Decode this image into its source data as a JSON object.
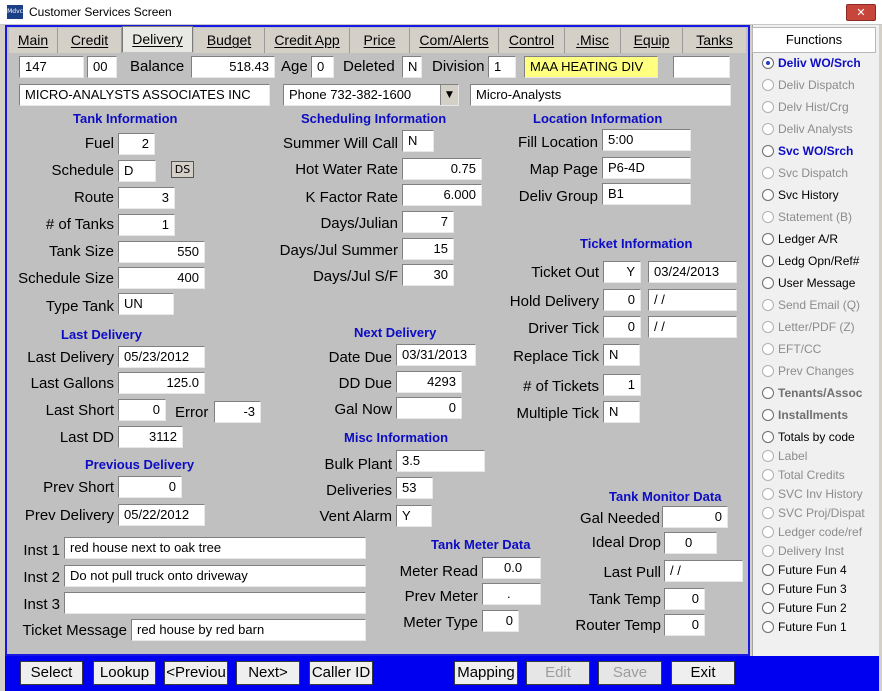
{
  "window": {
    "title": "Customer Services Screen",
    "app_icon_text": "Mdvc",
    "close_glyph": "✕"
  },
  "tabs": [
    "Main",
    "Credit",
    "Delivery",
    "Budget",
    "Credit App",
    "Price",
    "Com/Alerts",
    "Control",
    ".Misc",
    "Equip",
    "Tanks"
  ],
  "active_tab": "Delivery",
  "header": {
    "account": "147",
    "sub": "00",
    "balance_label": "Balance",
    "balance": "518.43",
    "age_label": "Age",
    "age": "0",
    "deleted_label": "Deleted",
    "deleted": "N",
    "division_label": "Division",
    "division": "1",
    "division_name": "MAA HEATING  DIV",
    "extra": "",
    "company": "MICRO-ANALYSTS ASSOCIATES INC",
    "phone": "Phone 732-382-1600",
    "short_name": "Micro-Analysts"
  },
  "tank_info": {
    "title": "Tank Information",
    "fuel_label": "Fuel",
    "fuel": "2",
    "schedule_label": "Schedule",
    "schedule": "D",
    "ds_button": "DS",
    "route_label": "Route",
    "route": "3",
    "num_tanks_label": "# of Tanks",
    "num_tanks": "1",
    "tank_size_label": "Tank Size",
    "tank_size": "550",
    "schedule_size_label": "Schedule Size",
    "schedule_size": "400",
    "type_tank_label": "Type Tank",
    "type_tank": "UN"
  },
  "last_delivery": {
    "title": "Last Delivery",
    "last_delivery_label": "Last Delivery",
    "last_delivery": "05/23/2012",
    "last_gallons_label": "Last Gallons",
    "last_gallons": "125.0",
    "last_short_label": "Last Short",
    "last_short": "0",
    "error_label": "Error",
    "error": "-3",
    "last_dd_label": "Last DD",
    "last_dd": "3112"
  },
  "previous_delivery": {
    "title": "Previous Delivery",
    "prev_short_label": "Prev Short",
    "prev_short": "0",
    "prev_delivery_label": "Prev Delivery",
    "prev_delivery": "05/22/2012"
  },
  "instructions": {
    "inst1_label": "Inst 1",
    "inst1": "red house next to oak tree",
    "inst2_label": "Inst 2",
    "inst2": "Do not pull truck onto driveway",
    "inst3_label": "Inst 3",
    "inst3": "",
    "ticket_message_label": "Ticket Message",
    "ticket_message": "red house by red barn"
  },
  "scheduling": {
    "title": "Scheduling Information",
    "summer_will_call_label": "Summer Will Call",
    "summer_will_call": "N",
    "hot_water_rate_label": "Hot Water Rate",
    "hot_water_rate": "0.75",
    "k_factor_rate_label": "K Factor Rate",
    "k_factor_rate": "6.000",
    "days_julian_label": "Days/Julian",
    "days_julian": "7",
    "days_jul_summer_label": "Days/Jul Summer",
    "days_jul_summer": "15",
    "days_jul_sf_label": "Days/Jul S/F",
    "days_jul_sf": "30"
  },
  "next_delivery": {
    "title": "Next Delivery",
    "date_due_label": "Date Due",
    "date_due": "03/31/2013",
    "dd_due_label": "DD Due",
    "dd_due": "4293",
    "gal_now_label": "Gal Now",
    "gal_now": "0"
  },
  "misc_info": {
    "title": "Misc Information",
    "bulk_plant_label": "Bulk Plant",
    "bulk_plant": "3.5",
    "deliveries_label": "Deliveries",
    "deliveries": "53",
    "vent_alarm_label": "Vent Alarm",
    "vent_alarm": "Y"
  },
  "tank_meter": {
    "title": "Tank Meter Data",
    "meter_read_label": "Meter Read",
    "meter_read": "0.0",
    "prev_meter_label": "Prev Meter",
    "prev_meter": ".",
    "meter_type_label": "Meter Type",
    "meter_type": "0"
  },
  "location": {
    "title": "Location Information",
    "fill_location_label": "Fill Location",
    "fill_location": "5:00",
    "map_page_label": "Map Page",
    "map_page": "P6-4D",
    "deliv_group_label": "Deliv Group",
    "deliv_group": "B1"
  },
  "ticket": {
    "title": "Ticket Information",
    "ticket_out_label": "Ticket Out",
    "ticket_out": "Y",
    "ticket_out_date": "03/24/2013",
    "hold_delivery_label": "Hold Delivery",
    "hold_delivery": "0",
    "hold_delivery_date": " / /",
    "driver_tick_label": "Driver Tick",
    "driver_tick": "0",
    "driver_tick_date": " / /",
    "replace_tick_label": "Replace Tick",
    "replace_tick": "N",
    "num_tickets_label": "# of Tickets",
    "num_tickets": "1",
    "multiple_tick_label": "Multiple Tick",
    "multiple_tick": "N"
  },
  "tank_monitor": {
    "title": "Tank Monitor Data",
    "gal_needed_label": "Gal Needed",
    "gal_needed": "0",
    "ideal_drop_label": "Ideal Drop",
    "ideal_drop": "0",
    "last_pull_label": "Last Pull",
    "last_pull": " / /",
    "tank_temp_label": "Tank Temp",
    "tank_temp": "0",
    "router_temp_label": "Router Temp",
    "router_temp": "0"
  },
  "functions": {
    "title": "Functions",
    "items": [
      "Deliv WO/Srch",
      "Deliv Dispatch",
      "Delv Hist/Crg",
      "Deliv Analysts",
      "Svc WO/Srch",
      "Svc Dispatch",
      "Svc History",
      "Statement (B)",
      "Ledger A/R",
      "Ledg Opn/Ref#",
      "User Message",
      "Send Email (Q)",
      "Letter/PDF (Z)",
      "EFT/CC",
      "Prev Changes",
      "Tenants/Assoc",
      "Installments",
      "Totals by code",
      "Label",
      "Total Credits",
      "SVC Inv History",
      "SVC Proj/Dispat",
      "Ledger code/ref",
      "Delivery Inst",
      "Future Fun 4",
      "Future Fun 3",
      "Future Fun 2",
      "Future Fun 1"
    ]
  },
  "bottom_buttons": [
    "Select",
    "Lookup",
    "<Previou",
    "Next>",
    "Caller ID",
    "Mapping",
    "Edit",
    "Save",
    "Exit"
  ],
  "colors": {
    "frame_blue": "#1818e0",
    "bottom_bar_blue": "#0000f0",
    "header_blue": "#0c0cc4",
    "division_yellow": "#ffff80",
    "panel_gray": "#c0c0c0"
  }
}
